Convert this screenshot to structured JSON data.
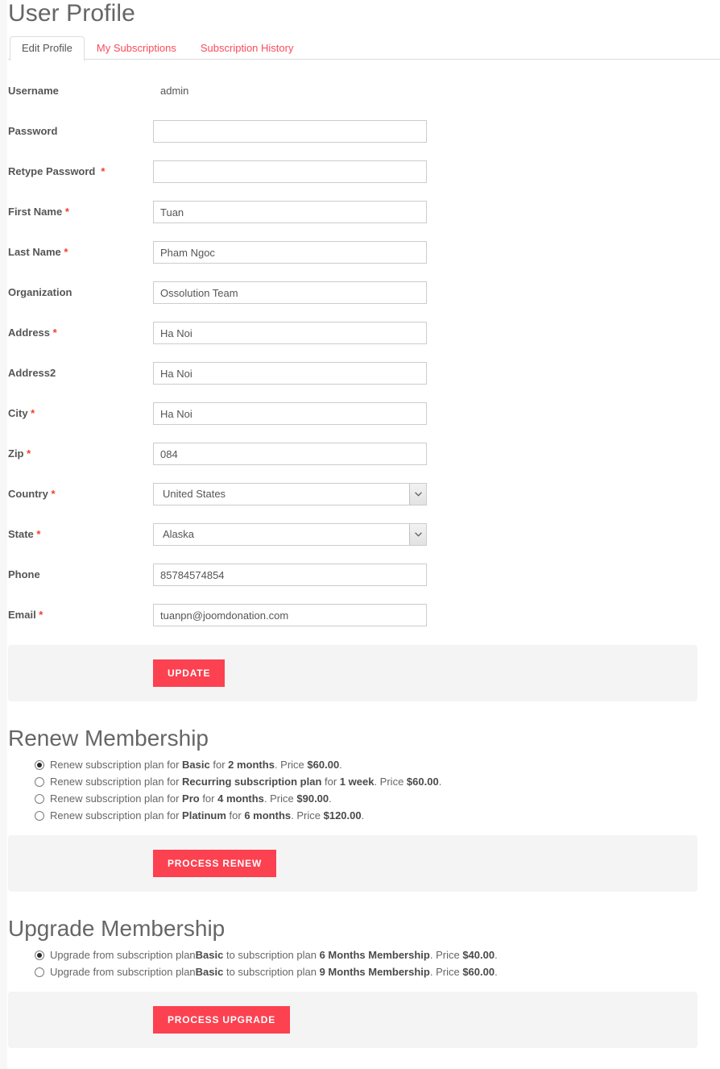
{
  "page": {
    "title": "User Profile"
  },
  "tabs": [
    {
      "label": "Edit Profile",
      "active": true
    },
    {
      "label": "My Subscriptions",
      "active": false
    },
    {
      "label": "Subscription History",
      "active": false
    }
  ],
  "profile_form": {
    "fields": [
      {
        "label": "Username",
        "required": false,
        "type": "static",
        "value": "admin",
        "placeholder": ""
      },
      {
        "label": "Password",
        "required": false,
        "type": "password",
        "value": "",
        "placeholder": ""
      },
      {
        "label": "Retype Password",
        "required": true,
        "required_wide": true,
        "type": "password",
        "value": "",
        "placeholder": ""
      },
      {
        "label": "First Name",
        "required": true,
        "type": "text",
        "value": "Tuan",
        "placeholder": ""
      },
      {
        "label": "Last Name",
        "required": true,
        "type": "text",
        "value": "Pham Ngoc",
        "placeholder": ""
      },
      {
        "label": "Organization",
        "required": false,
        "type": "text",
        "value": "Ossolution Team",
        "placeholder": ""
      },
      {
        "label": "Address",
        "required": true,
        "type": "text",
        "value": "Ha Noi",
        "placeholder": ""
      },
      {
        "label": "Address2",
        "required": false,
        "type": "text",
        "value": "Ha Noi",
        "placeholder": ""
      },
      {
        "label": "City",
        "required": true,
        "type": "text",
        "value": "Ha Noi",
        "placeholder": ""
      },
      {
        "label": "Zip",
        "required": true,
        "type": "text",
        "value": "084",
        "placeholder": ""
      },
      {
        "label": "Country",
        "required": true,
        "type": "select",
        "value": "United States",
        "placeholder": ""
      },
      {
        "label": "State",
        "required": true,
        "type": "select",
        "value": "Alaska",
        "placeholder": ""
      },
      {
        "label": "Phone",
        "required": false,
        "type": "text",
        "value": "85784574854",
        "placeholder": ""
      },
      {
        "label": "Email",
        "required": true,
        "type": "text",
        "value": "tuanpn@joomdonation.com",
        "placeholder": ""
      }
    ],
    "submit_label": "Update"
  },
  "renew": {
    "title": "Renew Membership",
    "options": [
      {
        "checked": true,
        "parts": [
          {
            "text": "Renew subscription plan for ",
            "bold": false
          },
          {
            "text": "Basic",
            "bold": true
          },
          {
            "text": " for ",
            "bold": false
          },
          {
            "text": "2 months",
            "bold": true
          },
          {
            "text": ". Price ",
            "bold": false
          },
          {
            "text": "$60.00",
            "bold": true
          },
          {
            "text": ".",
            "bold": false
          }
        ]
      },
      {
        "checked": false,
        "parts": [
          {
            "text": "Renew subscription plan for ",
            "bold": false
          },
          {
            "text": "Recurring subscription plan",
            "bold": true
          },
          {
            "text": " for ",
            "bold": false
          },
          {
            "text": "1 week",
            "bold": true
          },
          {
            "text": ". Price ",
            "bold": false
          },
          {
            "text": "$60.00",
            "bold": true
          },
          {
            "text": ".",
            "bold": false
          }
        ]
      },
      {
        "checked": false,
        "parts": [
          {
            "text": "Renew subscription plan for ",
            "bold": false
          },
          {
            "text": "Pro",
            "bold": true
          },
          {
            "text": " for ",
            "bold": false
          },
          {
            "text": "4 months",
            "bold": true
          },
          {
            "text": ". Price ",
            "bold": false
          },
          {
            "text": "$90.00",
            "bold": true
          },
          {
            "text": ".",
            "bold": false
          }
        ]
      },
      {
        "checked": false,
        "parts": [
          {
            "text": "Renew subscription plan for ",
            "bold": false
          },
          {
            "text": "Platinum",
            "bold": true
          },
          {
            "text": " for ",
            "bold": false
          },
          {
            "text": "6 months",
            "bold": true
          },
          {
            "text": ". Price ",
            "bold": false
          },
          {
            "text": "$120.00",
            "bold": true
          },
          {
            "text": ".",
            "bold": false
          }
        ]
      }
    ],
    "submit_label": "Process Renew"
  },
  "upgrade": {
    "title": "Upgrade Membership",
    "options": [
      {
        "checked": true,
        "parts": [
          {
            "text": "Upgrade from subscription plan",
            "bold": false
          },
          {
            "text": "Basic",
            "bold": true
          },
          {
            "text": " to subscription plan ",
            "bold": false
          },
          {
            "text": "6 Months Membership",
            "bold": true
          },
          {
            "text": ". Price ",
            "bold": false
          },
          {
            "text": "$40.00",
            "bold": true
          },
          {
            "text": ".",
            "bold": false
          }
        ]
      },
      {
        "checked": false,
        "parts": [
          {
            "text": "Upgrade from subscription plan",
            "bold": false
          },
          {
            "text": "Basic",
            "bold": true
          },
          {
            "text": " to subscription plan ",
            "bold": false
          },
          {
            "text": "9 Months Membership",
            "bold": true
          },
          {
            "text": ". Price ",
            "bold": false
          },
          {
            "text": "$60.00",
            "bold": true
          },
          {
            "text": ".",
            "bold": false
          }
        ]
      }
    ],
    "submit_label": "Process Upgrade"
  },
  "icons": {
    "chevron_down": "chevron-down-icon"
  },
  "colors": {
    "accent_red": "#fc4150",
    "link_red": "#fb4b5b",
    "required_red": "#f0402b",
    "heading_gray": "#666666",
    "panel_gray": "#f4f4f4",
    "border_gray": "#dddddd"
  }
}
